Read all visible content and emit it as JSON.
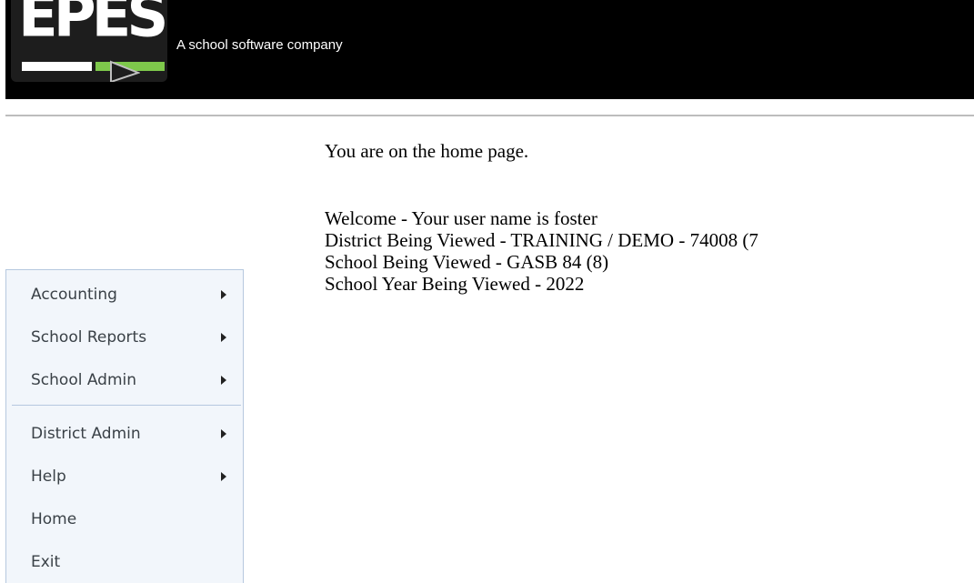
{
  "header": {
    "logo_text": "EPES",
    "tagline": "A school software company"
  },
  "main": {
    "intro": "You are on the home page.",
    "welcome": "Welcome - Your user name is foster",
    "district": "District Being Viewed - TRAINING / DEMO - 74008 (7",
    "school": "School Being Viewed - GASB 84 (8)",
    "school_year": "School Year Being Viewed - 2022"
  },
  "menu": {
    "items": [
      {
        "label": "Accounting",
        "has_submenu": true
      },
      {
        "label": "School Reports",
        "has_submenu": true
      },
      {
        "label": "School Admin",
        "has_submenu": true
      },
      {
        "label": "District Admin",
        "has_submenu": true
      },
      {
        "label": "Help",
        "has_submenu": true
      },
      {
        "label": "Home",
        "has_submenu": false
      },
      {
        "label": "Exit",
        "has_submenu": false
      }
    ]
  },
  "colors": {
    "header_bg": "#000000",
    "logo_green": "#7ec84b",
    "menu_bg": "#f2f6fb",
    "menu_border": "#b6c8df",
    "menu_text": "#3a4147"
  },
  "icons": {
    "submenu": "chevron-right-icon",
    "logo_cursor": "cursor-arrow-icon"
  }
}
